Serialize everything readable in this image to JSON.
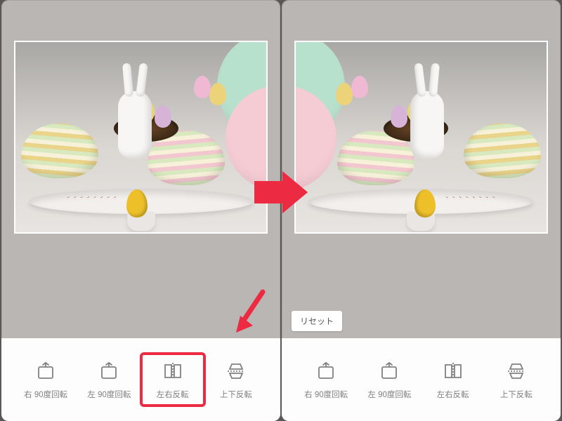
{
  "arrow_color": "#ec2b43",
  "highlight_color": "#ec2b43",
  "reset_label": "リセット",
  "left_panel": {
    "selected_tool_index": 2,
    "tools": [
      {
        "id": "rotate-right",
        "label": "右 90度回転"
      },
      {
        "id": "rotate-left",
        "label": "左 90度回転"
      },
      {
        "id": "flip-horizontal",
        "label": "左右反転"
      },
      {
        "id": "flip-vertical",
        "label": "上下反転"
      }
    ]
  },
  "right_panel": {
    "selected_tool_index": -1,
    "tools": [
      {
        "id": "rotate-right",
        "label": "右 90度回転"
      },
      {
        "id": "rotate-left",
        "label": "左 90度回転"
      },
      {
        "id": "flip-horizontal",
        "label": "左右反転"
      },
      {
        "id": "flip-vertical",
        "label": "上下反転"
      }
    ]
  }
}
